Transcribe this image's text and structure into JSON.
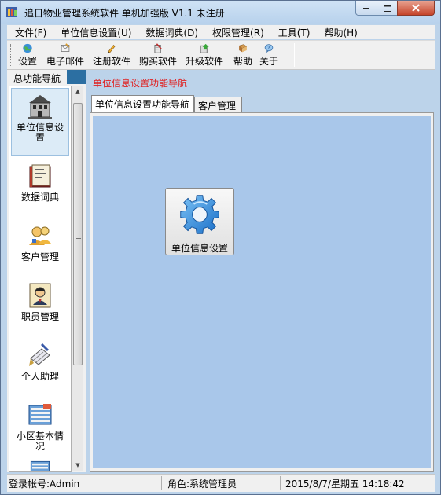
{
  "window": {
    "title": "追日物业管理系统软件 单机加强版 V1.1 未注册"
  },
  "menu": [
    "文件(F)",
    "单位信息设置(U)",
    "数据词典(D)",
    "权限管理(R)",
    "工具(T)",
    "帮助(H)"
  ],
  "toolbar": [
    {
      "label": "设置",
      "icon": "globe-icon"
    },
    {
      "label": "电子邮件",
      "icon": "email-icon"
    },
    {
      "label": "注册软件",
      "icon": "pencil-icon"
    },
    {
      "label": "购买软件",
      "icon": "book-pen-icon"
    },
    {
      "label": "升级软件",
      "icon": "upgrade-icon"
    },
    {
      "label": "帮助",
      "icon": "help-book-icon"
    },
    {
      "label": "关于",
      "icon": "about-icon"
    }
  ],
  "nav": {
    "header": "总功能导航",
    "items": [
      {
        "label": "单位信息设置",
        "icon": "building-icon",
        "selected": true
      },
      {
        "label": "数据词典",
        "icon": "dictionary-icon"
      },
      {
        "label": "客户管理",
        "icon": "customers-icon"
      },
      {
        "label": "职员管理",
        "icon": "employee-icon"
      },
      {
        "label": "个人助理",
        "icon": "assistant-icon"
      },
      {
        "label": "小区基本情况",
        "icon": "community-icon"
      }
    ]
  },
  "main": {
    "title": "单位信息设置功能导航",
    "tabs": [
      "单位信息设置功能导航",
      "客户管理"
    ],
    "active_tab": 0,
    "buttons": [
      {
        "label": "单位信息设置",
        "icon": "gear-icon"
      }
    ]
  },
  "status": {
    "login": "登录帐号:Admin",
    "role": "角色:系统管理员",
    "datetime": "2015/8/7/星期五 14:18:42"
  },
  "colors": {
    "accent": "#2c6fa2",
    "title_red": "#e02020",
    "content_bg": "#a9c7ea"
  }
}
